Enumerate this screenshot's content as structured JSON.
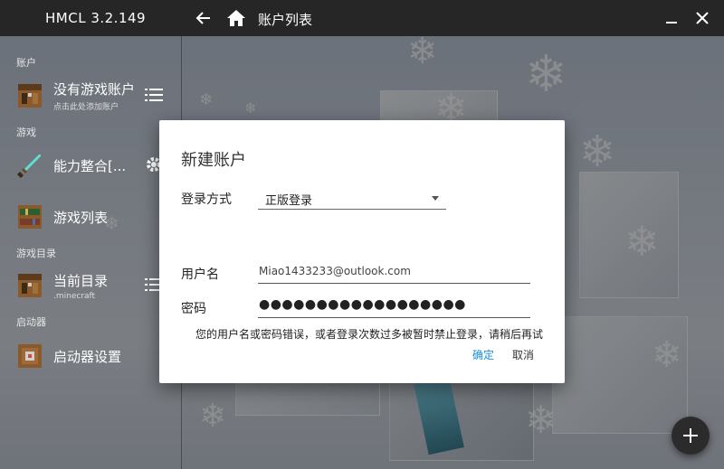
{
  "titlebar": {
    "app_title": "HMCL 3.2.149",
    "page_title": "账户列表",
    "icons": [
      "back-arrow-icon",
      "home-icon",
      "minimize-icon",
      "close-icon"
    ]
  },
  "sidebar": {
    "sections": {
      "account": "账户",
      "game": "游戏",
      "game_dir": "游戏目录",
      "launcher": "启动器"
    },
    "items": {
      "no_account": {
        "label": "没有游戏账户",
        "sub": "点击此处添加账户",
        "icon": "crafting-table-icon"
      },
      "modpack": {
        "label": "能力整合[...",
        "icon": "diamond-sword-icon"
      },
      "game_list": {
        "label": "游戏列表",
        "icon": "bookshelf-icon"
      },
      "current_dir": {
        "label": "当前目录",
        "sub": ".minecraft",
        "icon": "crafting-table-icon"
      },
      "launcher_settings": {
        "label": "启动器设置",
        "icon": "furnace-icon"
      }
    }
  },
  "dialog": {
    "title": "新建账户",
    "login_method_label": "登录方式",
    "login_method_value": "正版登录",
    "username_label": "用户名",
    "username_value": "Miao1433233@outlook.com",
    "password_label": "密码",
    "password_value": "●●●●●●●●●●●●●●●●●●",
    "error_message": "您的用户名或密码错误，或者登录次数过多被暂时禁止登录，请稍后再试",
    "confirm_label": "确定",
    "cancel_label": "取消"
  },
  "colors": {
    "titlebar": "#262626",
    "accent": "#1a8fd1",
    "dialog_bg": "#ffffff"
  }
}
